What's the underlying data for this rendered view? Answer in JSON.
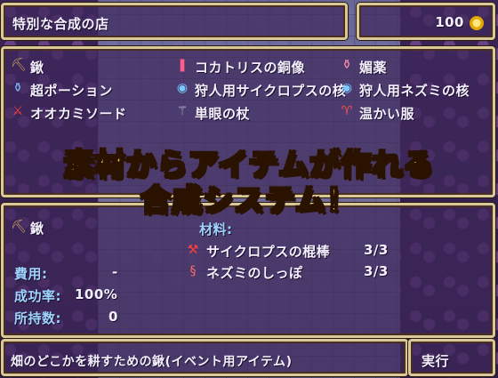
{
  "title": "特別な合成の店",
  "gold": {
    "amount": "100",
    "icon": "gold-coin-icon"
  },
  "items": [
    {
      "label": "鍬",
      "icon": "pickaxe-icon",
      "color": "#c9a063"
    },
    {
      "label": "コカトリスの銅像",
      "icon": "statue-icon",
      "color": "#ff5c8a"
    },
    {
      "label": "媚薬",
      "icon": "potion-icon",
      "color": "#ff8cb0"
    },
    {
      "label": "超ポーション",
      "icon": "potion-icon",
      "color": "#7fb8ff"
    },
    {
      "label": "狩人用サイクロプスの核",
      "icon": "core-orb-icon",
      "color": "#7ac8ff"
    },
    {
      "label": "狩人用ネズミの核",
      "icon": "core-orb-icon",
      "color": "#7ac8ff"
    },
    {
      "label": "オオカミソード",
      "icon": "sword-icon",
      "color": "#ff4040"
    },
    {
      "label": "単眼の杖",
      "icon": "staff-icon",
      "color": "#c0c0d8"
    },
    {
      "label": "温かい服",
      "icon": "clothes-icon",
      "color": "#ff5050"
    }
  ],
  "banner": {
    "line1": "素材からアイテムが作れる",
    "line2": "合成システム！"
  },
  "detail": {
    "name": "鍬",
    "materials_label": "材料:",
    "materials": [
      {
        "name": "サイクロプスの棍棒",
        "count": "3/3",
        "icon": "club-icon"
      },
      {
        "name": "ネズミのしっぽ",
        "count": "3/3",
        "icon": "tail-icon"
      }
    ],
    "cost_label": "費用:",
    "cost_value": "-",
    "success_label": "成功率:",
    "success_value": "100%",
    "owned_label": "所持数:",
    "owned_value": "0"
  },
  "description": "畑のどこかを耕すための鍬(イベント用アイテム)",
  "execute_label": "実行"
}
